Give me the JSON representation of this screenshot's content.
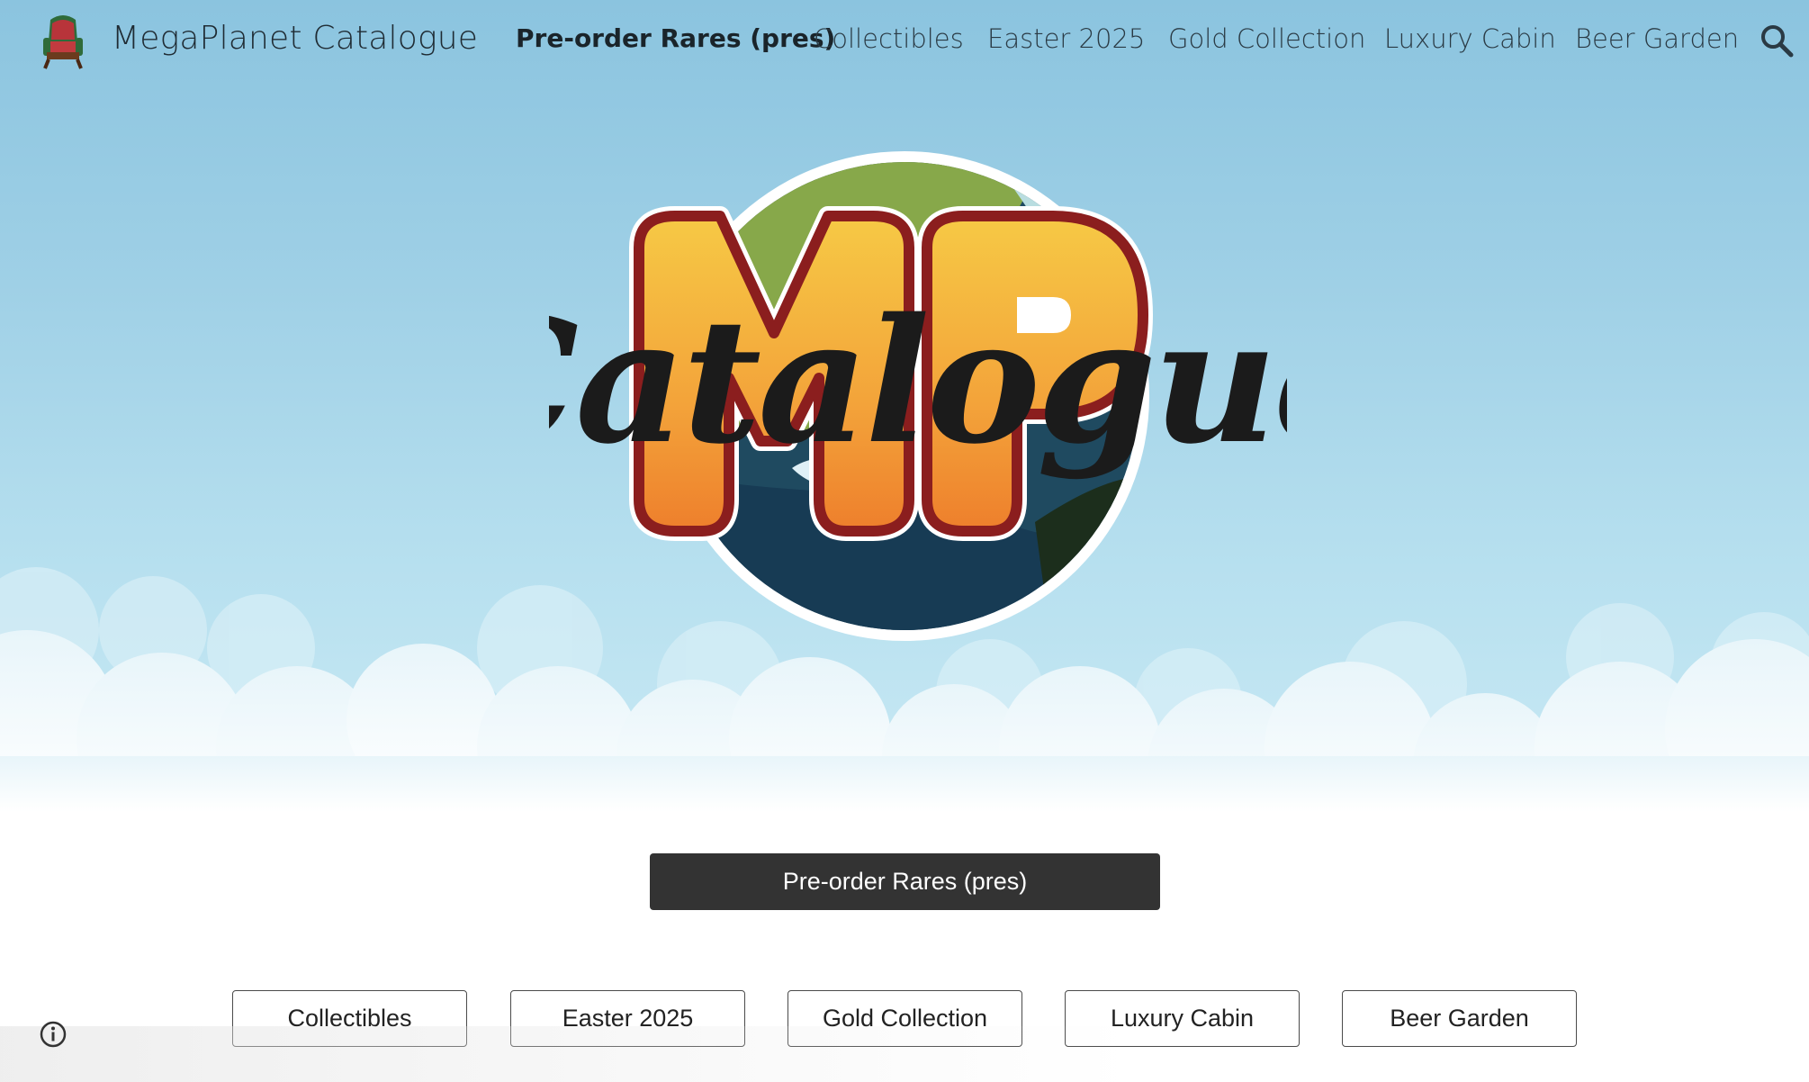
{
  "header": {
    "site_title": "MegaPlanet Catalogue",
    "logo_icon": "armchair-icon",
    "nav": [
      {
        "label": "Pre-order Rares (pres)",
        "active": true
      },
      {
        "label": "Collectibles",
        "active": false
      },
      {
        "label": "Easter 2025",
        "active": false
      },
      {
        "label": "Gold Collection",
        "active": false
      },
      {
        "label": "Luxury Cabin",
        "active": false
      },
      {
        "label": "Beer Garden",
        "active": false
      }
    ],
    "search_icon": "search-icon"
  },
  "hero": {
    "logo_letters": "MP",
    "logo_script": "Catalogue",
    "colors": {
      "sky_top": "#8bc4df",
      "letter_fill": "#f5c042",
      "letter_outline": "#8b1e1e",
      "script": "#1b1b1b"
    }
  },
  "main": {
    "primary_button": "Pre-order Rares (pres)",
    "category_buttons": [
      "Collectibles",
      "Easter 2025",
      "Gold Collection",
      "Luxury Cabin",
      "Beer Garden"
    ]
  },
  "footer": {
    "info_icon": "info-icon"
  }
}
